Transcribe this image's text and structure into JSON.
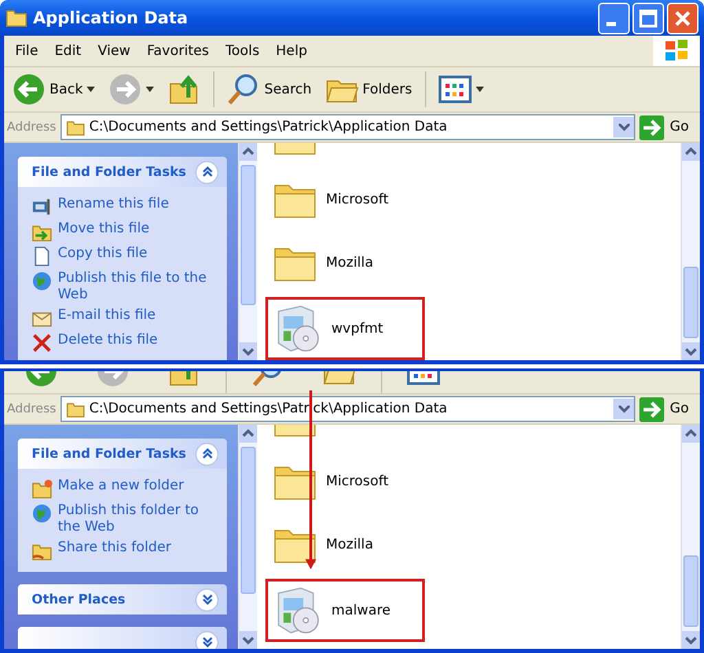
{
  "windows": [
    {
      "title": "Application Data",
      "menu": [
        "File",
        "Edit",
        "View",
        "Favorites",
        "Tools",
        "Help"
      ],
      "toolbar": [
        {
          "kind": "back",
          "label": "Back",
          "caret": true
        },
        {
          "kind": "forward",
          "caret": true
        },
        {
          "kind": "up"
        },
        {
          "kind": "divider"
        },
        {
          "kind": "search",
          "label": "Search"
        },
        {
          "kind": "folders",
          "label": "Folders"
        },
        {
          "kind": "divider"
        },
        {
          "kind": "views",
          "caret": true
        }
      ],
      "address": {
        "label": "Address",
        "value": "C:\\Documents and Settings\\Patrick\\Application Data",
        "go": "Go"
      },
      "panels": [
        {
          "title": "File and Folder Tasks",
          "expanded": true,
          "items": [
            {
              "kind": "rename",
              "label": "Rename this file"
            },
            {
              "kind": "move",
              "label": "Move this file"
            },
            {
              "kind": "copy",
              "label": "Copy this file"
            },
            {
              "kind": "globe",
              "label": "Publish this file to the Web"
            },
            {
              "kind": "email",
              "label": "E-mail this file"
            },
            {
              "kind": "delete",
              "label": "Delete this file"
            }
          ]
        }
      ],
      "files": [
        {
          "kind": "folder",
          "highlighted": false
        },
        {
          "kind": "folder",
          "name": "Microsoft",
          "highlighted": false
        },
        {
          "kind": "folder",
          "name": "Mozilla",
          "highlighted": false
        },
        {
          "kind": "installer",
          "name": "wvpfmt",
          "highlighted": true
        }
      ]
    },
    {
      "toolbar": [
        {
          "kind": "back"
        },
        {
          "kind": "forward"
        },
        {
          "kind": "up"
        },
        {
          "kind": "divider"
        },
        {
          "kind": "search"
        },
        {
          "kind": "folders"
        },
        {
          "kind": "divider"
        },
        {
          "kind": "views"
        }
      ],
      "address": {
        "label": "Address",
        "value": "C:\\Documents and Settings\\Patrick\\Application Data",
        "go": "Go"
      },
      "panels": [
        {
          "title": "File and Folder Tasks",
          "expanded": true,
          "items": [
            {
              "kind": "newfolder",
              "label": "Make a new folder"
            },
            {
              "kind": "globe",
              "label": "Publish this folder to the Web"
            },
            {
              "kind": "share",
              "label": "Share this folder"
            }
          ]
        },
        {
          "title": "Other Places",
          "expanded": false
        },
        {
          "expanded": false
        }
      ],
      "files": [
        {
          "kind": "folder",
          "highlighted": false
        },
        {
          "kind": "folder",
          "name": "Microsoft",
          "highlighted": false
        },
        {
          "kind": "folder",
          "name": "Mozilla",
          "highlighted": false
        },
        {
          "kind": "installer",
          "name": "malware",
          "highlighted": true
        }
      ]
    }
  ]
}
